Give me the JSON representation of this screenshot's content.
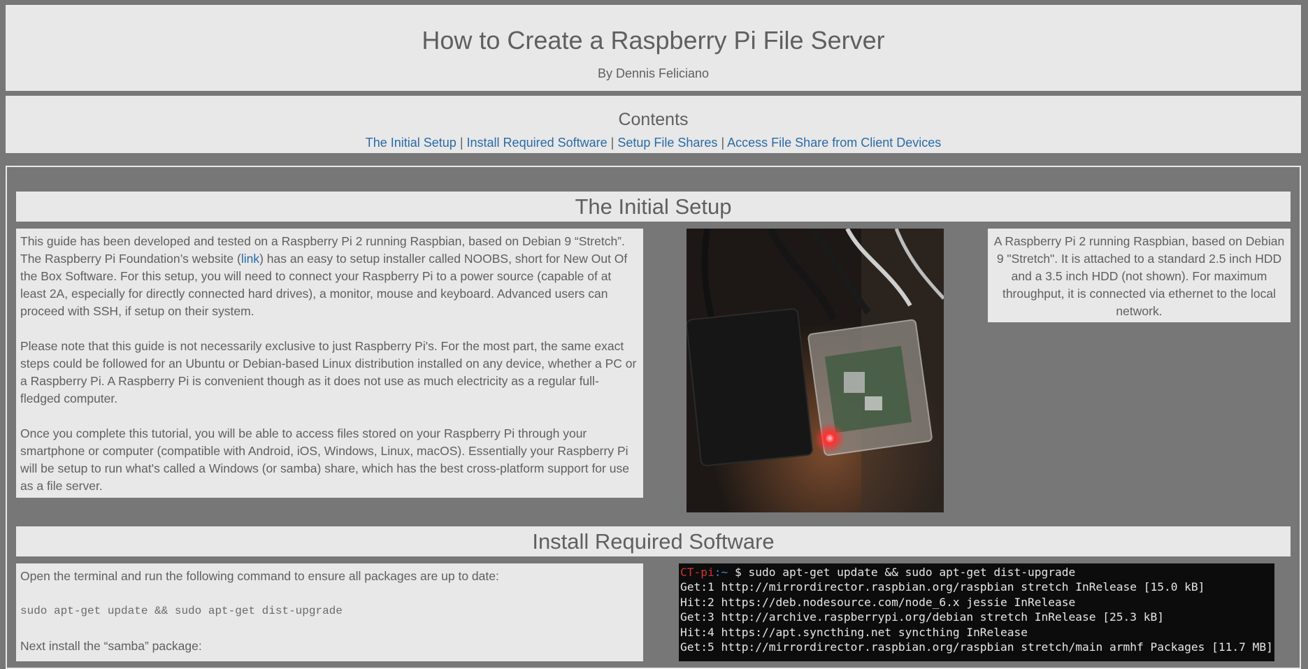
{
  "header": {
    "title": "How to Create a Raspberry Pi File Server",
    "author": "By Dennis Feliciano"
  },
  "contents": {
    "title": "Contents",
    "links": [
      "The Initial Setup",
      "Install Required Software",
      "Setup File Shares",
      "Access File Share from Client Devices"
    ],
    "separator": "|"
  },
  "initial_setup": {
    "title": "The Initial Setup",
    "p1_before_link": "This guide has been developed and tested on a Raspberry Pi 2 running Raspbian, based on Debian 9 “Stretch”. The Raspberry Pi Foundation’s website (",
    "p1_link": "link",
    "p1_after_link": ") has an easy to setup installer called NOOBS, short for New Out Of the Box Software. For this setup, you will need to connect your Raspberry Pi to a power source (capable of at least 2A, especially for directly connected hard drives), a monitor, mouse and keyboard. Advanced users can proceed with SSH, if setup on their system.",
    "p2": "Please note that this guide is not necessarily exclusive to just Raspberry Pi's. For the most part, the same exact steps could be followed for an Ubuntu or Debian-based Linux distribution installed on any device, whether a PC or a Raspberry Pi. A Raspberry Pi is convenient though as it does not use as much electricity as a regular full-fledged computer.",
    "p3": "Once you complete this tutorial, you will be able to access files stored on your Raspberry Pi through your smartphone or computer (compatible with Android, iOS, Windows, Linux, macOS). Essentially your Raspberry Pi will be setup to run what's called a Windows (or samba) share, which has the best cross-platform support for use as a file server.",
    "caption": "A Raspberry Pi 2 running Raspbian, based on Debian 9 \"Stretch\". It is attached to a standard 2.5 inch HDD and a 3.5 inch HDD (not shown). For maximum throughput, it is connected via ethernet to the local network."
  },
  "install_software": {
    "title": "Install Required Software",
    "p1": "Open the terminal and run the following command to ensure all packages are up to date:",
    "command": "sudo apt-get update && sudo apt-get dist-upgrade",
    "p2": "Next install the “samba” package:"
  },
  "terminal": {
    "host": "CT-pi",
    "path": ":~",
    "prompt_cmd": " $ sudo apt-get update && sudo apt-get dist-upgrade",
    "lines": [
      "Get:1 http://mirrordirector.raspbian.org/raspbian stretch InRelease [15.0 kB]",
      "Hit:2 https://deb.nodesource.com/node_6.x jessie InRelease",
      "Get:3 http://archive.raspberrypi.org/debian stretch InRelease [25.3 kB]",
      "Hit:4 https://apt.syncthing.net syncthing InRelease",
      "Get:5 http://mirrordirector.raspbian.org/raspbian stretch/main armhf Packages [11.7 MB]"
    ]
  },
  "colors": {
    "background": "#777777",
    "panel": "#e8e8e8",
    "link": "#2a6aa6",
    "terminal_bg": "#0c0c0c",
    "terminal_host": "#d23232"
  }
}
